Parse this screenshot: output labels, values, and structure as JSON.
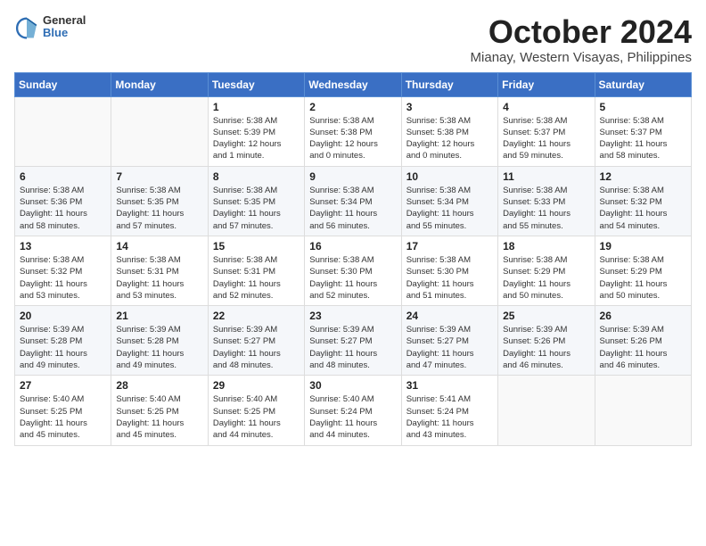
{
  "header": {
    "logo": {
      "general": "General",
      "blue": "Blue"
    },
    "title": "October 2024",
    "location": "Mianay, Western Visayas, Philippines"
  },
  "days_of_week": [
    "Sunday",
    "Monday",
    "Tuesday",
    "Wednesday",
    "Thursday",
    "Friday",
    "Saturday"
  ],
  "weeks": [
    [
      {
        "day": "",
        "info": ""
      },
      {
        "day": "",
        "info": ""
      },
      {
        "day": "1",
        "info": "Sunrise: 5:38 AM\nSunset: 5:39 PM\nDaylight: 12 hours\nand 1 minute."
      },
      {
        "day": "2",
        "info": "Sunrise: 5:38 AM\nSunset: 5:38 PM\nDaylight: 12 hours\nand 0 minutes."
      },
      {
        "day": "3",
        "info": "Sunrise: 5:38 AM\nSunset: 5:38 PM\nDaylight: 12 hours\nand 0 minutes."
      },
      {
        "day": "4",
        "info": "Sunrise: 5:38 AM\nSunset: 5:37 PM\nDaylight: 11 hours\nand 59 minutes."
      },
      {
        "day": "5",
        "info": "Sunrise: 5:38 AM\nSunset: 5:37 PM\nDaylight: 11 hours\nand 58 minutes."
      }
    ],
    [
      {
        "day": "6",
        "info": "Sunrise: 5:38 AM\nSunset: 5:36 PM\nDaylight: 11 hours\nand 58 minutes."
      },
      {
        "day": "7",
        "info": "Sunrise: 5:38 AM\nSunset: 5:35 PM\nDaylight: 11 hours\nand 57 minutes."
      },
      {
        "day": "8",
        "info": "Sunrise: 5:38 AM\nSunset: 5:35 PM\nDaylight: 11 hours\nand 57 minutes."
      },
      {
        "day": "9",
        "info": "Sunrise: 5:38 AM\nSunset: 5:34 PM\nDaylight: 11 hours\nand 56 minutes."
      },
      {
        "day": "10",
        "info": "Sunrise: 5:38 AM\nSunset: 5:34 PM\nDaylight: 11 hours\nand 55 minutes."
      },
      {
        "day": "11",
        "info": "Sunrise: 5:38 AM\nSunset: 5:33 PM\nDaylight: 11 hours\nand 55 minutes."
      },
      {
        "day": "12",
        "info": "Sunrise: 5:38 AM\nSunset: 5:32 PM\nDaylight: 11 hours\nand 54 minutes."
      }
    ],
    [
      {
        "day": "13",
        "info": "Sunrise: 5:38 AM\nSunset: 5:32 PM\nDaylight: 11 hours\nand 53 minutes."
      },
      {
        "day": "14",
        "info": "Sunrise: 5:38 AM\nSunset: 5:31 PM\nDaylight: 11 hours\nand 53 minutes."
      },
      {
        "day": "15",
        "info": "Sunrise: 5:38 AM\nSunset: 5:31 PM\nDaylight: 11 hours\nand 52 minutes."
      },
      {
        "day": "16",
        "info": "Sunrise: 5:38 AM\nSunset: 5:30 PM\nDaylight: 11 hours\nand 52 minutes."
      },
      {
        "day": "17",
        "info": "Sunrise: 5:38 AM\nSunset: 5:30 PM\nDaylight: 11 hours\nand 51 minutes."
      },
      {
        "day": "18",
        "info": "Sunrise: 5:38 AM\nSunset: 5:29 PM\nDaylight: 11 hours\nand 50 minutes."
      },
      {
        "day": "19",
        "info": "Sunrise: 5:38 AM\nSunset: 5:29 PM\nDaylight: 11 hours\nand 50 minutes."
      }
    ],
    [
      {
        "day": "20",
        "info": "Sunrise: 5:39 AM\nSunset: 5:28 PM\nDaylight: 11 hours\nand 49 minutes."
      },
      {
        "day": "21",
        "info": "Sunrise: 5:39 AM\nSunset: 5:28 PM\nDaylight: 11 hours\nand 49 minutes."
      },
      {
        "day": "22",
        "info": "Sunrise: 5:39 AM\nSunset: 5:27 PM\nDaylight: 11 hours\nand 48 minutes."
      },
      {
        "day": "23",
        "info": "Sunrise: 5:39 AM\nSunset: 5:27 PM\nDaylight: 11 hours\nand 48 minutes."
      },
      {
        "day": "24",
        "info": "Sunrise: 5:39 AM\nSunset: 5:27 PM\nDaylight: 11 hours\nand 47 minutes."
      },
      {
        "day": "25",
        "info": "Sunrise: 5:39 AM\nSunset: 5:26 PM\nDaylight: 11 hours\nand 46 minutes."
      },
      {
        "day": "26",
        "info": "Sunrise: 5:39 AM\nSunset: 5:26 PM\nDaylight: 11 hours\nand 46 minutes."
      }
    ],
    [
      {
        "day": "27",
        "info": "Sunrise: 5:40 AM\nSunset: 5:25 PM\nDaylight: 11 hours\nand 45 minutes."
      },
      {
        "day": "28",
        "info": "Sunrise: 5:40 AM\nSunset: 5:25 PM\nDaylight: 11 hours\nand 45 minutes."
      },
      {
        "day": "29",
        "info": "Sunrise: 5:40 AM\nSunset: 5:25 PM\nDaylight: 11 hours\nand 44 minutes."
      },
      {
        "day": "30",
        "info": "Sunrise: 5:40 AM\nSunset: 5:24 PM\nDaylight: 11 hours\nand 44 minutes."
      },
      {
        "day": "31",
        "info": "Sunrise: 5:41 AM\nSunset: 5:24 PM\nDaylight: 11 hours\nand 43 minutes."
      },
      {
        "day": "",
        "info": ""
      },
      {
        "day": "",
        "info": ""
      }
    ]
  ]
}
